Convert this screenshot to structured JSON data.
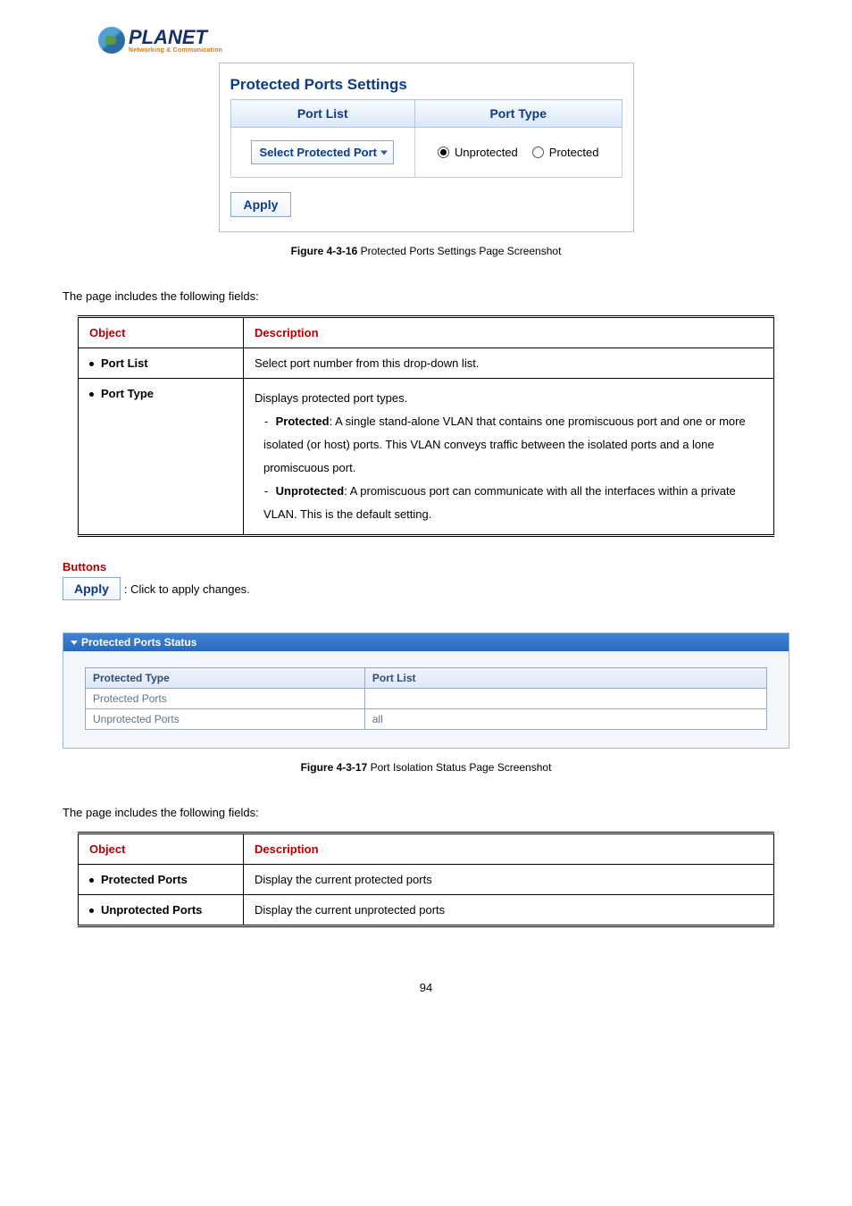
{
  "logo": {
    "brand": "PLANET",
    "tagline": "Networking & Communication"
  },
  "settings_panel": {
    "title": "Protected Ports Settings",
    "col_port_list": "Port List",
    "col_port_type": "Port Type",
    "dropdown_label": "Select Protected Port",
    "radio_unprotected": "Unprotected",
    "radio_protected": "Protected",
    "apply_label": "Apply"
  },
  "fig1": {
    "num": "Figure 4-3-16",
    "text": " Protected Ports Settings Page Screenshot"
  },
  "intro": "The page includes the following fields:",
  "table1": {
    "h_object": "Object",
    "h_desc": "Description",
    "r1_obj": "Port List",
    "r1_desc": "Select port number from this drop-down list.",
    "r2_obj": "Port Type",
    "r2_l1": "Displays protected port types.",
    "r2_b1_label": "Protected",
    "r2_b1_text": ": A single stand-alone VLAN that contains one promiscuous port and one or more isolated (or host) ports. This VLAN conveys traffic between the isolated ports and a lone promiscuous port.",
    "r2_b2_label": "Unprotected",
    "r2_b2_text": ": A promiscuous port can communicate with all the interfaces within a private VLAN. This is the default setting."
  },
  "buttons": {
    "header": "Buttons",
    "apply_label": "Apply",
    "apply_desc": ": Click to apply changes."
  },
  "status_panel": {
    "title": "Protected Ports Status",
    "col_type": "Protected Type",
    "col_list": "Port List",
    "row_protected": "Protected Ports",
    "row_protected_val": "",
    "row_unprotected": "Unprotected Ports",
    "row_unprotected_val": "all"
  },
  "fig2": {
    "num": "Figure 4-3-17",
    "text": " Port Isolation Status Page Screenshot"
  },
  "intro2": "The page includes the following fields:",
  "table2": {
    "h_object": "Object",
    "h_desc": "Description",
    "r1_obj": "Protected Ports",
    "r1_desc": "Display the current protected ports",
    "r2_obj": "Unprotected Ports",
    "r2_desc": "Display the current unprotected ports"
  },
  "page_number": "94"
}
